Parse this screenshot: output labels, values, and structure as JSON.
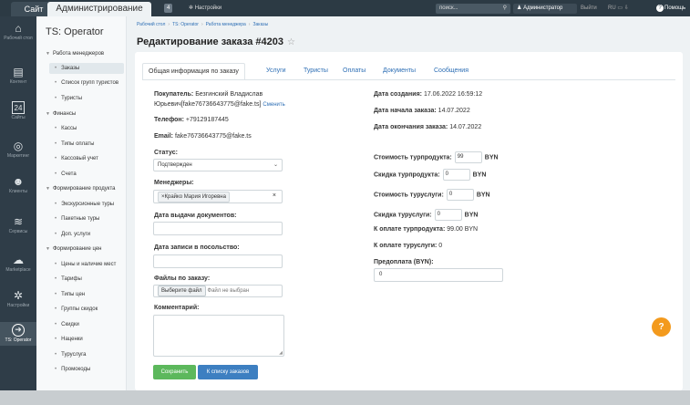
{
  "topbar": {
    "site_tab": "Сайт",
    "admin_tab": "Администрирование",
    "notif_count": "4",
    "settings": "Настройки",
    "search_placeholder": "поиск...",
    "user": "Администратор",
    "exit": "Выйти",
    "lang": "RU",
    "help": "Помощь"
  },
  "leftbar": [
    {
      "label": "Рабочий стол",
      "icon": "home-icon",
      "glyph": "⌂"
    },
    {
      "label": "Контент",
      "icon": "document-icon",
      "glyph": "▤"
    },
    {
      "label": "Сайты",
      "icon": "calendar-icon",
      "glyph": "24"
    },
    {
      "label": "Маркетинг",
      "icon": "target-icon",
      "glyph": "◎"
    },
    {
      "label": "Клиенты",
      "icon": "clients-icon",
      "glyph": "☻"
    },
    {
      "label": "Сервисы",
      "icon": "layers-icon",
      "glyph": "≋"
    },
    {
      "label": "Marketplace",
      "icon": "cloud-icon",
      "glyph": "☁"
    },
    {
      "label": "Настройки",
      "icon": "gear-icon",
      "glyph": "✲"
    },
    {
      "label": "TS: Operator",
      "icon": "arrow-right-icon",
      "glyph": "➜"
    }
  ],
  "menu": {
    "title": "TS: Operator",
    "items": [
      "Работа менеджеров",
      "Заказы",
      "Список групп туристов",
      "Туристы",
      "Финансы",
      "Кассы",
      "Типы оплаты",
      "Кассовый учет",
      "Счета",
      "Формирование продукта",
      "Экскурсионные туры",
      "Пакетные туры",
      "Доп. услуги",
      "Формирование цен",
      "Цены и наличие мест",
      "Тарифы",
      "Типы цен",
      "Группы скидок",
      "Скидки",
      "Наценки",
      "Туруслуга",
      "Промокоды"
    ]
  },
  "breadcrumb": [
    "Рабочий стол",
    "TS: Operator",
    "Работа менеджера",
    "Заказы"
  ],
  "page": {
    "title": "Редактирование заказа #4203"
  },
  "tabs": [
    "Общая информация по заказу",
    "Услуги",
    "Туристы",
    "Оплаты",
    "Документы",
    "Сообщения"
  ],
  "form": {
    "buyer_label": "Покупатель:",
    "buyer_value": "Безгинский Владислав",
    "buyer_value2": "Юрьевич[fake76736643775@fake.ts]",
    "change_link": "Сменить",
    "phone_label": "Телефон:",
    "phone_value": "+79129187445",
    "email_label": "Email:",
    "email_value": "fake76736643775@fake.ts",
    "status_label": "Статус:",
    "status_value": "Подтвержден",
    "managers_label": "Менеджеры:",
    "manager_chip": "Крайко Мария Игоревна",
    "docs_date_label": "Дата выдачи документов:",
    "embassy_date_label": "Дата записи в посольство:",
    "files_label": "Файлы по заказу:",
    "file_button": "Выберите файл",
    "file_note": "Файл не выбран",
    "comment_label": "Комментарий:",
    "save": "Сохранить",
    "to_list": "К списку заказов"
  },
  "right": {
    "created_label": "Дата создания:",
    "created_value": "17.06.2022 16:59:12",
    "start_label": "Дата начала заказа:",
    "start_value": "14.07.2022",
    "end_label": "Дата окончания заказа:",
    "end_value": "14.07.2022",
    "tp_cost_label": "Стоимость турпродукта:",
    "tp_cost_value": "99",
    "tp_disc_label": "Скидка турпродукта:",
    "tp_disc_value": "0",
    "ts_cost_label": "Стоимость туруслуги:",
    "ts_cost_value": "0",
    "ts_disc_label": "Скидка туруслуги:",
    "ts_disc_value": "0",
    "currency": "BYN",
    "pay_tp_label": "К оплате турпродукта:",
    "pay_tp_value": "99.00 BYN",
    "pay_ts_label": "К оплате туруслуги:",
    "pay_ts_value": "0",
    "prepay_label": "Предоплата (BYN):",
    "prepay_value": "0"
  },
  "help_bubble": "?"
}
